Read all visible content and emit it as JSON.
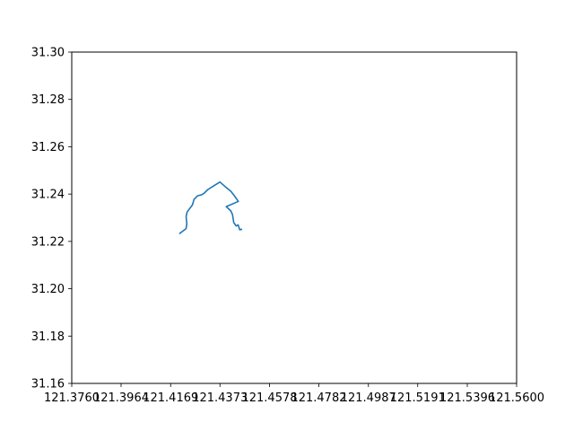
{
  "chart_data": {
    "type": "line",
    "title": "",
    "xlabel": "",
    "ylabel": "",
    "xlim": [
      121.376,
      121.56
    ],
    "ylim": [
      31.16,
      31.3
    ],
    "xticks": [
      "121.3760",
      "121.3964",
      "121.4169",
      "121.4373",
      "121.4578",
      "121.4782",
      "121.4987",
      "121.5191",
      "121.5396",
      "121.5600"
    ],
    "yticks": [
      "31.16",
      "31.18",
      "31.20",
      "31.22",
      "31.24",
      "31.26",
      "31.28",
      "31.30"
    ],
    "grid": false,
    "series_color": "#1f77b4",
    "series": [
      {
        "x": [
          121.4207,
          121.4233,
          121.4236,
          121.4233,
          121.4237,
          121.4259,
          121.4266,
          121.4281,
          121.4297,
          121.4307,
          121.4323,
          121.4349,
          121.4373,
          121.4394,
          121.4418,
          121.4434,
          121.4449,
          121.4399,
          121.4418,
          121.4425,
          121.443,
          121.444,
          121.4448,
          121.4455,
          121.4462
        ],
        "y": [
          31.2234,
          31.2254,
          31.2275,
          31.2304,
          31.2324,
          31.2354,
          31.2378,
          31.2393,
          31.2397,
          31.2403,
          31.2419,
          31.2436,
          31.2451,
          31.2432,
          31.2412,
          31.2391,
          31.2369,
          31.2347,
          31.2329,
          31.2313,
          31.228,
          31.2265,
          31.227,
          31.2249,
          31.2251
        ]
      }
    ]
  }
}
